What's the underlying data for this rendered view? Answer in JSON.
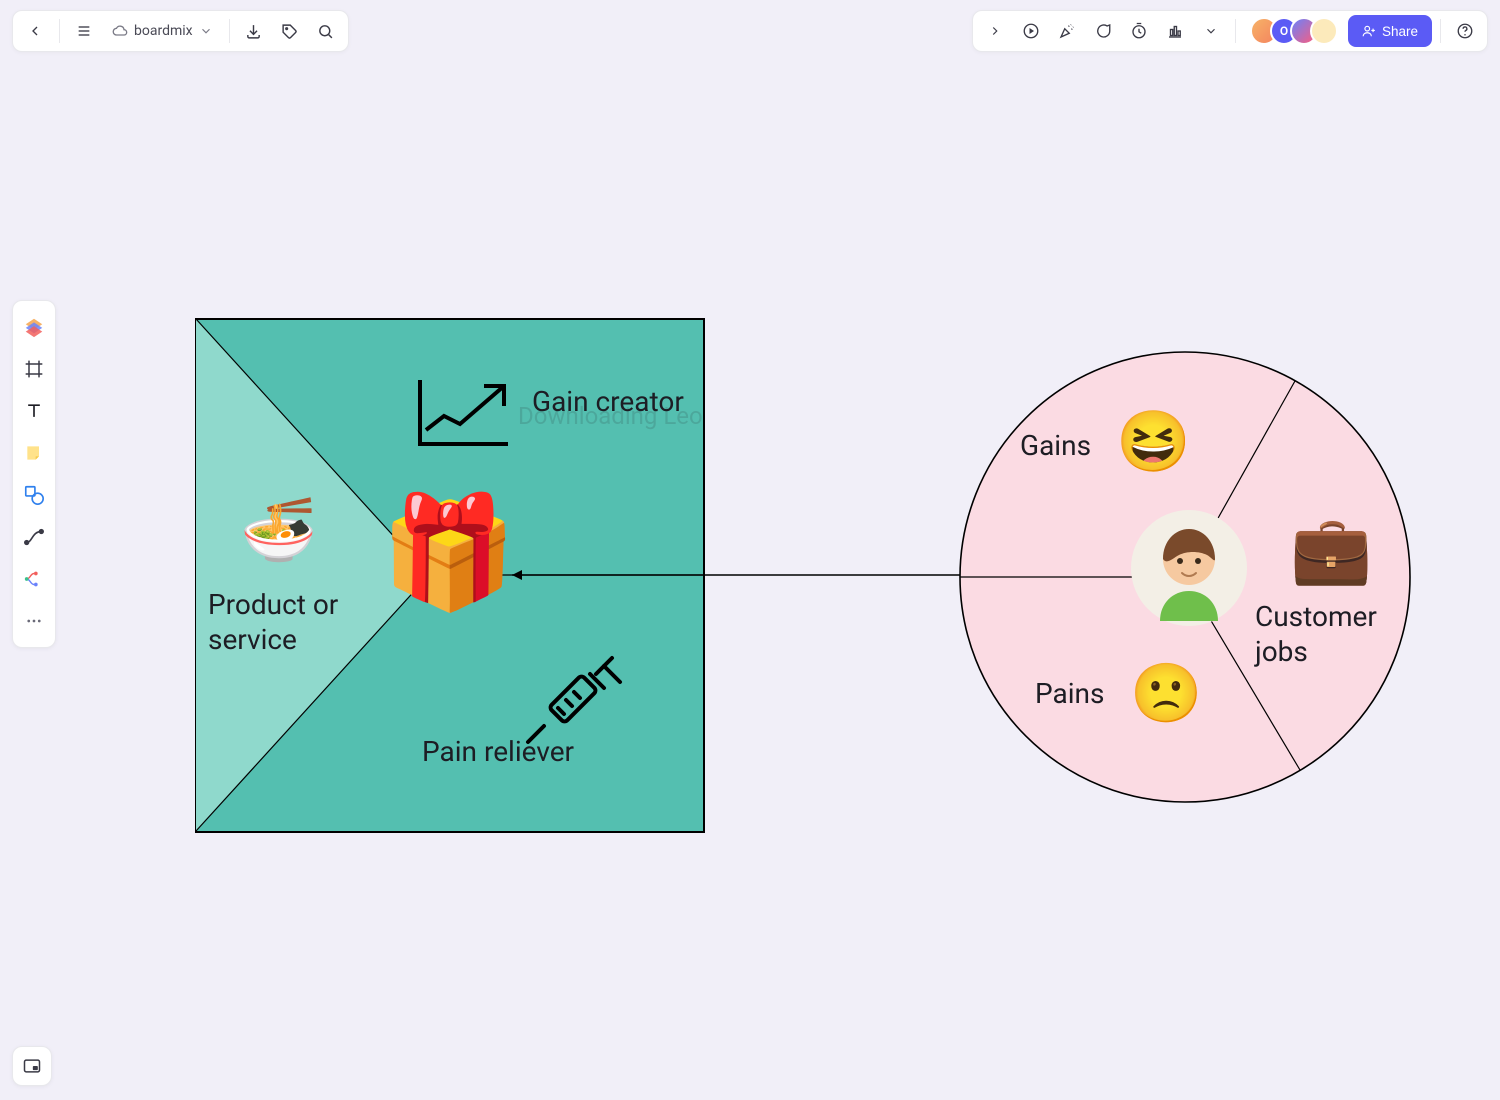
{
  "app": {
    "doc_name": "boardmix"
  },
  "toolbar_right": {
    "share_label": "Share",
    "avatars": [
      {
        "initial": ""
      },
      {
        "initial": "O"
      },
      {
        "initial": ""
      },
      {
        "initial": ""
      }
    ]
  },
  "left_tools": [
    {
      "name": "brand-logo-icon"
    },
    {
      "name": "frame-icon"
    },
    {
      "name": "text-icon"
    },
    {
      "name": "sticky-note-icon"
    },
    {
      "name": "shape-icon"
    },
    {
      "name": "connector-icon"
    },
    {
      "name": "mindmap-icon"
    },
    {
      "name": "more-icon"
    }
  ],
  "diagram": {
    "value_map": {
      "product_label": "Product or service",
      "gain_creator_label": "Gain creator",
      "pain_reliever_label": "Pain reliever",
      "watermark": "Downloading Leo"
    },
    "customer_profile": {
      "gains_label": "Gains",
      "pains_label": "Pains",
      "jobs_label": "Customer jobs"
    }
  }
}
